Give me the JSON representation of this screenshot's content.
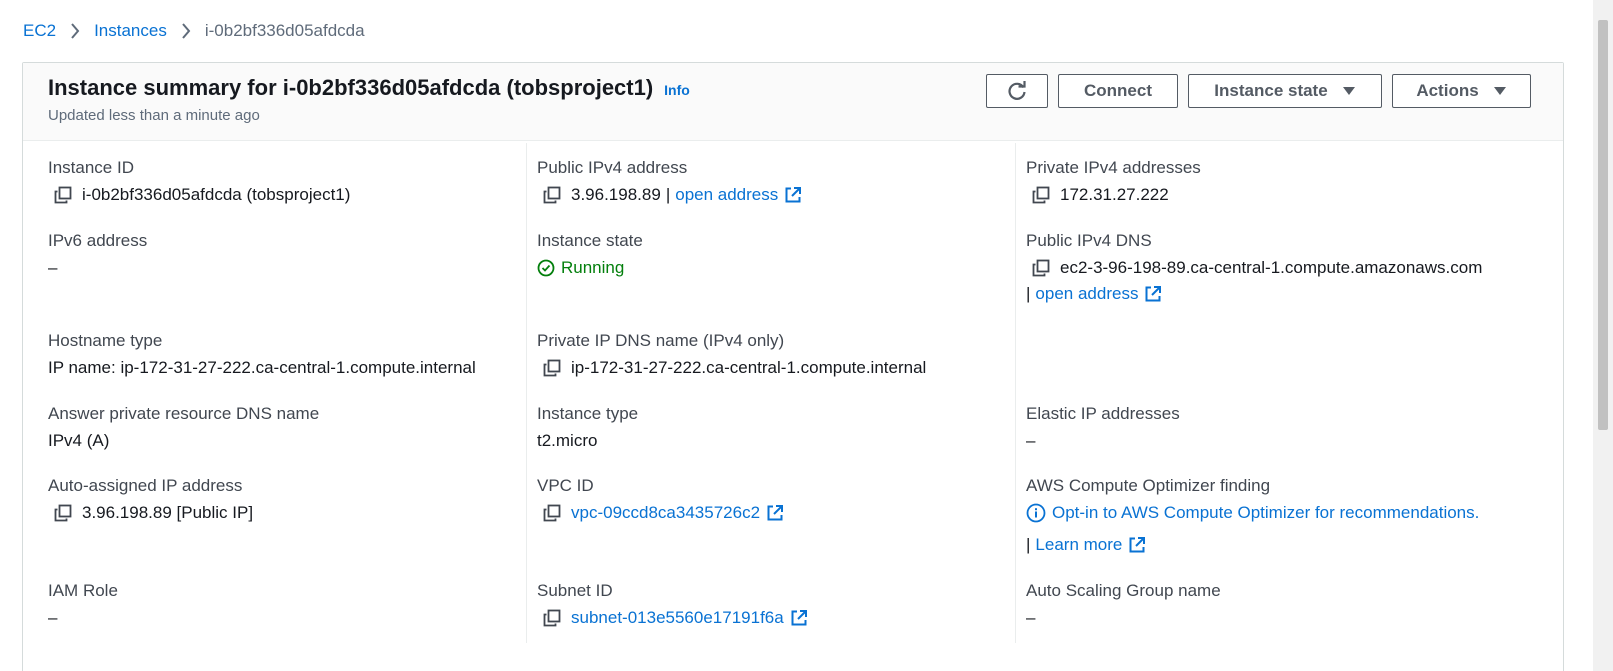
{
  "breadcrumb": {
    "items": [
      "EC2",
      "Instances"
    ],
    "current": "i-0b2bf336d05afdcda"
  },
  "header": {
    "title": "Instance summary for i-0b2bf336d05afdcda (tobsproject1)",
    "info": "Info",
    "subtitle": "Updated less than a minute ago",
    "connect": "Connect",
    "instance_state": "Instance state",
    "actions": "Actions"
  },
  "fields": {
    "instance_id": {
      "label": "Instance ID",
      "value": "i-0b2bf336d05afdcda (tobsproject1)"
    },
    "public_ipv4": {
      "label": "Public IPv4 address",
      "value": "3.96.198.89",
      "sep": "|",
      "link": "open address"
    },
    "private_ipv4": {
      "label": "Private IPv4 addresses",
      "value": "172.31.27.222"
    },
    "ipv6": {
      "label": "IPv6 address",
      "value": "–"
    },
    "instance_state": {
      "label": "Instance state",
      "value": "Running"
    },
    "public_dns": {
      "label": "Public IPv4 DNS",
      "value": "ec2-3-96-198-89.ca-central-1.compute.amazonaws.com",
      "sep": "|",
      "link": "open address"
    },
    "hostname_type": {
      "label": "Hostname type",
      "value": "IP name: ip-172-31-27-222.ca-central-1.compute.internal"
    },
    "private_dns": {
      "label": "Private IP DNS name (IPv4 only)",
      "value": "ip-172-31-27-222.ca-central-1.compute.internal"
    },
    "answer_dns": {
      "label": "Answer private resource DNS name",
      "value": "IPv4 (A)"
    },
    "instance_type": {
      "label": "Instance type",
      "value": "t2.micro"
    },
    "elastic_ip": {
      "label": "Elastic IP addresses",
      "value": "–"
    },
    "auto_ip": {
      "label": "Auto-assigned IP address",
      "value": "3.96.198.89 [Public IP]"
    },
    "vpc_id": {
      "label": "VPC ID",
      "value": "vpc-09ccd8ca3435726c2"
    },
    "optimizer": {
      "label": "AWS Compute Optimizer finding",
      "value": "Opt-in to AWS Compute Optimizer for recommendations.",
      "sep": "|",
      "link": "Learn more"
    },
    "iam_role": {
      "label": "IAM Role",
      "value": "–"
    },
    "subnet_id": {
      "label": "Subnet ID",
      "value": "subnet-013e5560e17191f6a"
    },
    "asg_name": {
      "label": "Auto Scaling Group name",
      "value": "–"
    }
  },
  "colors": {
    "link": "#0972d3",
    "running": "#037f0c",
    "text": "#16191f",
    "label": "#414750"
  }
}
